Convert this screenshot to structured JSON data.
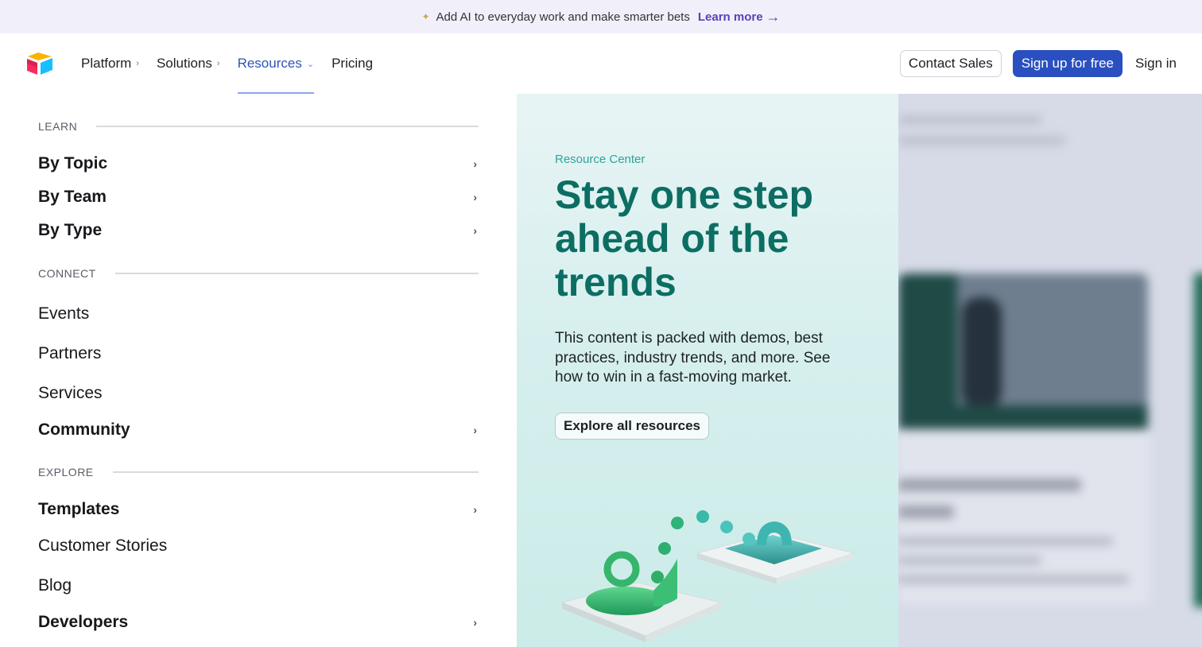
{
  "announcement": {
    "sparkle_icon": "sparkle-icon",
    "text": "Add AI to everyday work and make smarter bets",
    "link_label": "Learn more",
    "link_icon": "arrow-right-icon"
  },
  "nav": {
    "logo_icon": "airtable-logo",
    "items": [
      {
        "label": "Platform",
        "has_chevron": true,
        "active": false
      },
      {
        "label": "Solutions",
        "has_chevron": true,
        "active": false
      },
      {
        "label": "Resources",
        "has_chevron": true,
        "active": true
      },
      {
        "label": "Pricing",
        "has_chevron": false,
        "active": false
      }
    ],
    "contact_sales": "Contact Sales",
    "sign_up": "Sign up for free",
    "sign_in": "Sign in"
  },
  "menu": {
    "learn_heading": "LEARN",
    "learn_items": [
      {
        "label": "By Topic",
        "has_chevron": true
      },
      {
        "label": "By Team",
        "has_chevron": true
      },
      {
        "label": "By Type",
        "has_chevron": true
      }
    ],
    "connect_heading": "CONNECT",
    "connect_items": [
      {
        "label": "Events",
        "has_chevron": false
      },
      {
        "label": "Partners",
        "has_chevron": false
      },
      {
        "label": "Services",
        "has_chevron": false
      },
      {
        "label": "Community",
        "has_chevron": true
      }
    ],
    "explore_heading": "EXPLORE",
    "explore_items": [
      {
        "label": "Templates",
        "has_chevron": true
      },
      {
        "label": "Customer Stories",
        "has_chevron": false
      },
      {
        "label": "Blog",
        "has_chevron": false
      },
      {
        "label": "Developers",
        "has_chevron": true
      }
    ],
    "chevron_icon": "chevron-right-icon"
  },
  "feature": {
    "eyebrow": "Resource Center",
    "headline": "Stay one step ahead of the trends",
    "description": "This content is packed with demos, best practices, industry trends, and more. See how to win in a fast-moving market.",
    "button": "Explore all resources"
  },
  "colors": {
    "accent_blue": "#2a4fc0",
    "nav_active": "#2d54b8",
    "teal_headline": "#0c6e62",
    "teal_eyebrow": "#2aa59a",
    "announce_link": "#5b3fb8"
  }
}
